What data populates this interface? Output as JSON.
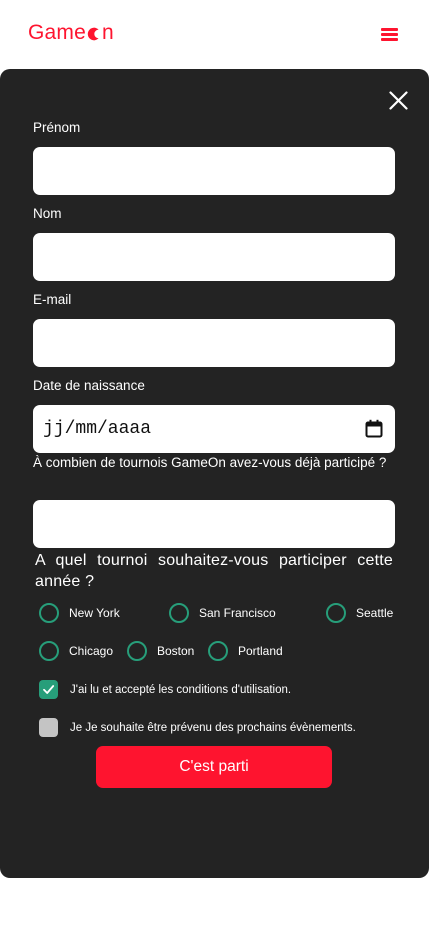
{
  "header": {
    "logo_prefix": "Game",
    "logo_suffix": "n",
    "logo_icon": "crescent-moon-logo",
    "menu_icon": "hamburger-icon",
    "brand_color": "#fe142f"
  },
  "modal": {
    "close_icon": "close-icon",
    "background": "#232323",
    "fields": {
      "first_name": {
        "label": "Prénom",
        "value": ""
      },
      "last_name": {
        "label": "Nom",
        "value": ""
      },
      "email": {
        "label": "E-mail",
        "value": ""
      },
      "birthdate": {
        "label": "Date de naissance",
        "placeholder": "jj/mm/aaaa",
        "icon": "calendar-icon"
      },
      "tournaments_count": {
        "label": "À combien de tournois GameOn avez-vous déjà participé ?",
        "value": ""
      }
    },
    "location_question": "A quel tournoi souhaitez-vous participer cette année ?",
    "locations": [
      "New York",
      "San Francisco",
      "Seattle",
      "Chicago",
      "Boston",
      "Portland"
    ],
    "accent_color": "#279e7a",
    "checkboxes": {
      "terms": {
        "label": "J'ai lu et accepté les conditions d'utilisation.",
        "checked": true
      },
      "newsletter": {
        "label": "Je Je souhaite être prévenu des prochains évènements.",
        "checked": false
      }
    },
    "submit_label": "C'est parti"
  }
}
